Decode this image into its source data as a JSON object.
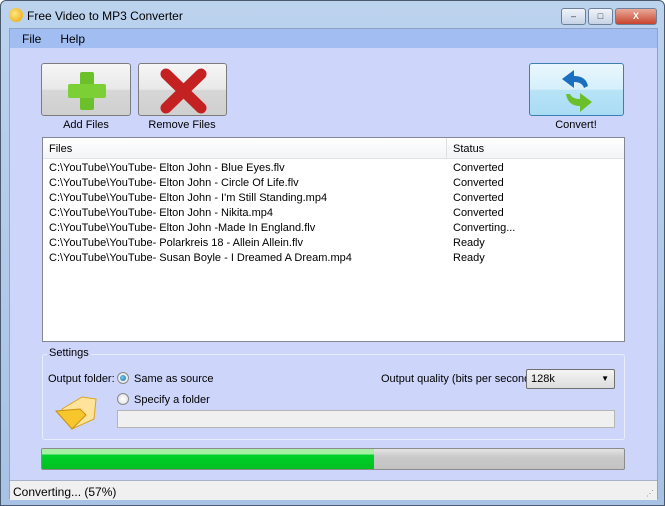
{
  "window": {
    "title": "Free Video to MP3 Converter",
    "minimize": "–",
    "maximize": "□",
    "close": "X"
  },
  "menu": [
    "File",
    "Help"
  ],
  "toolbar": {
    "add_label": "Add Files",
    "remove_label": "Remove Files",
    "convert_label": "Convert!"
  },
  "list": {
    "headers": {
      "files": "Files",
      "status": "Status"
    },
    "rows": [
      {
        "file": "C:\\YouTube\\YouTube- Elton John - Blue Eyes.flv",
        "status": "Converted"
      },
      {
        "file": "C:\\YouTube\\YouTube- Elton John - Circle Of Life.flv",
        "status": "Converted"
      },
      {
        "file": "C:\\YouTube\\YouTube- Elton John - I'm Still Standing.mp4",
        "status": "Converted"
      },
      {
        "file": "C:\\YouTube\\YouTube- Elton John - Nikita.mp4",
        "status": "Converted"
      },
      {
        "file": "C:\\YouTube\\YouTube- Elton John -Made In England.flv",
        "status": "Converting..."
      },
      {
        "file": "C:\\YouTube\\YouTube- Polarkreis 18 - Allein Allein.flv",
        "status": "Ready"
      },
      {
        "file": "C:\\YouTube\\YouTube- Susan Boyle - I Dreamed A Dream.mp4",
        "status": "Ready"
      }
    ]
  },
  "settings": {
    "title": "Settings",
    "output_folder_label": "Output folder:",
    "same_as_source": "Same as source",
    "specify_folder": "Specify a folder",
    "selected": "same_as_source",
    "folder_path": "",
    "quality_label": "Output quality (bits per second):",
    "quality_value": "128k"
  },
  "progress": {
    "percent": 57
  },
  "status": {
    "text": "Converting... (57%)"
  }
}
